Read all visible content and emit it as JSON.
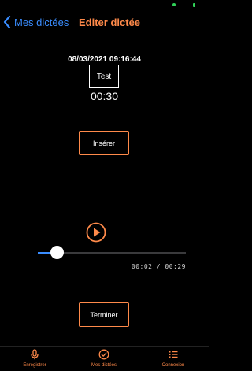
{
  "nav": {
    "back_label": "Mes dictées",
    "title": "Editer dictée"
  },
  "dictation": {
    "timestamp": "08/03/2021 09:16:44",
    "title": "Test",
    "duration": "00:30"
  },
  "buttons": {
    "insert_label": "Insérer",
    "finish_label": "Terminer"
  },
  "player": {
    "progress": 0.128,
    "time_readout": "00:02 / 00:29"
  },
  "tabs": [
    {
      "label": "Enregistrer",
      "icon": "microphone-icon"
    },
    {
      "label": "Mes dictées",
      "icon": "check-circle-icon"
    },
    {
      "label": "Connexion",
      "icon": "list-icon"
    }
  ],
  "colors": {
    "accent": "#ff8a4a",
    "link": "#3a8dff",
    "background": "#000000"
  }
}
